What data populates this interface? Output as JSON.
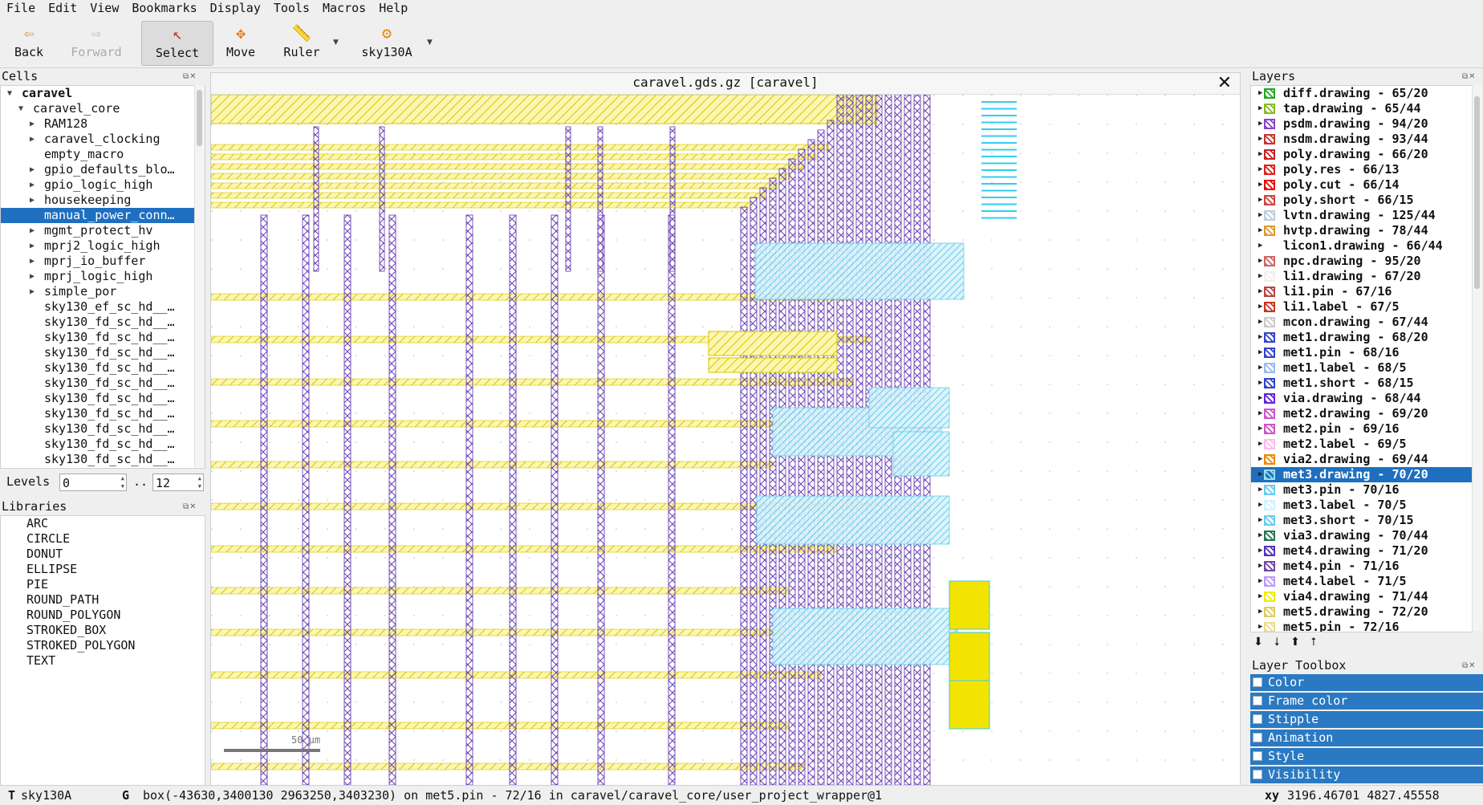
{
  "menu": [
    "File",
    "Edit",
    "View",
    "Bookmarks",
    "Display",
    "Tools",
    "Macros",
    "Help"
  ],
  "toolbar": {
    "back": "Back",
    "forward": "Forward",
    "select": "Select",
    "move": "Move",
    "ruler": "Ruler",
    "tech": "sky130A"
  },
  "cells": {
    "title": "Cells",
    "items": [
      {
        "label": "caravel",
        "indent": 0,
        "arrow": "open",
        "bold": true
      },
      {
        "label": "caravel_core",
        "indent": 1,
        "arrow": "open"
      },
      {
        "label": "RAM128",
        "indent": 2,
        "arrow": "closed"
      },
      {
        "label": "caravel_clocking",
        "indent": 2,
        "arrow": "closed"
      },
      {
        "label": "empty_macro",
        "indent": 2,
        "arrow": "none"
      },
      {
        "label": "gpio_defaults_blo…",
        "indent": 2,
        "arrow": "closed"
      },
      {
        "label": "gpio_logic_high",
        "indent": 2,
        "arrow": "closed"
      },
      {
        "label": "housekeeping",
        "indent": 2,
        "arrow": "closed"
      },
      {
        "label": "manual_power_conn…",
        "indent": 2,
        "arrow": "none",
        "selected": true
      },
      {
        "label": "mgmt_protect_hv",
        "indent": 2,
        "arrow": "closed"
      },
      {
        "label": "mprj2_logic_high",
        "indent": 2,
        "arrow": "closed"
      },
      {
        "label": "mprj_io_buffer",
        "indent": 2,
        "arrow": "closed"
      },
      {
        "label": "mprj_logic_high",
        "indent": 2,
        "arrow": "closed"
      },
      {
        "label": "simple_por",
        "indent": 2,
        "arrow": "closed"
      },
      {
        "label": "sky130_ef_sc_hd__…",
        "indent": 2,
        "arrow": "none"
      },
      {
        "label": "sky130_fd_sc_hd__…",
        "indent": 2,
        "arrow": "none"
      },
      {
        "label": "sky130_fd_sc_hd__…",
        "indent": 2,
        "arrow": "none"
      },
      {
        "label": "sky130_fd_sc_hd__…",
        "indent": 2,
        "arrow": "none"
      },
      {
        "label": "sky130_fd_sc_hd__…",
        "indent": 2,
        "arrow": "none"
      },
      {
        "label": "sky130_fd_sc_hd__…",
        "indent": 2,
        "arrow": "none"
      },
      {
        "label": "sky130_fd_sc_hd__…",
        "indent": 2,
        "arrow": "none"
      },
      {
        "label": "sky130_fd_sc_hd__…",
        "indent": 2,
        "arrow": "none"
      },
      {
        "label": "sky130_fd_sc_hd__…",
        "indent": 2,
        "arrow": "none"
      },
      {
        "label": "sky130_fd_sc_hd__…",
        "indent": 2,
        "arrow": "none"
      },
      {
        "label": "sky130_fd_sc_hd__…",
        "indent": 2,
        "arrow": "none"
      }
    ]
  },
  "levels": {
    "label": "Levels",
    "from": "0",
    "sep": "..",
    "to": "12"
  },
  "libraries": {
    "title": "Libraries",
    "items": [
      "ARC",
      "CIRCLE",
      "DONUT",
      "ELLIPSE",
      "PIE",
      "ROUND_PATH",
      "ROUND_POLYGON",
      "STROKED_BOX",
      "STROKED_POLYGON",
      "TEXT"
    ]
  },
  "canvas": {
    "title": "caravel.gds.gz [caravel]",
    "scale_label": "50 µm"
  },
  "layers": {
    "title": "Layers",
    "items": [
      {
        "label": "diff.drawing - 65/20",
        "color": "#22aa22"
      },
      {
        "label": "tap.drawing - 65/44",
        "color": "#88bb22"
      },
      {
        "label": "psdm.drawing - 94/20",
        "color": "#8844cc"
      },
      {
        "label": "nsdm.drawing - 93/44",
        "color": "#cc3333"
      },
      {
        "label": "poly.drawing - 66/20",
        "color": "#cc2222"
      },
      {
        "label": "poly.res - 66/13",
        "color": "#dd2222"
      },
      {
        "label": "poly.cut - 66/14",
        "color": "#ee0000"
      },
      {
        "label": "poly.short - 66/15",
        "color": "#cc4444"
      },
      {
        "label": "lvtn.drawing - 125/44",
        "color": "#bbccdd"
      },
      {
        "label": "hvtp.drawing - 78/44",
        "color": "#dd9933"
      },
      {
        "label": "licon1.drawing - 66/44",
        "color": "#ffffff"
      },
      {
        "label": "npc.drawing - 95/20",
        "color": "#cc6666"
      },
      {
        "label": "li1.drawing - 67/20",
        "color": "#f0f0f0"
      },
      {
        "label": "li1.pin - 67/16",
        "color": "#bb4444"
      },
      {
        "label": "li1.label - 67/5",
        "color": "#cc3322"
      },
      {
        "label": "mcon.drawing - 67/44",
        "color": "#cccccc"
      },
      {
        "label": "met1.drawing - 68/20",
        "color": "#3344cc"
      },
      {
        "label": "met1.pin - 68/16",
        "color": "#3344cc"
      },
      {
        "label": "met1.label - 68/5",
        "color": "#99bbee"
      },
      {
        "label": "met1.short - 68/15",
        "color": "#3344cc"
      },
      {
        "label": "via.drawing - 68/44",
        "color": "#6622dd"
      },
      {
        "label": "met2.drawing - 69/20",
        "color": "#cc55cc"
      },
      {
        "label": "met2.pin - 69/16",
        "color": "#cc55cc"
      },
      {
        "label": "met2.label - 69/5",
        "color": "#ffbbee"
      },
      {
        "label": "via2.drawing - 69/44",
        "color": "#ee8800"
      },
      {
        "label": "met3.drawing - 70/20",
        "color": "#99ddee",
        "selected": true
      },
      {
        "label": "met3.pin - 70/16",
        "color": "#66ccee"
      },
      {
        "label": "met3.label - 70/5",
        "color": "#ccf4ff"
      },
      {
        "label": "met3.short - 70/15",
        "color": "#66ccee"
      },
      {
        "label": "via3.drawing - 70/44",
        "color": "#227755"
      },
      {
        "label": "met4.drawing - 71/20",
        "color": "#5533bb"
      },
      {
        "label": "met4.pin - 71/16",
        "color": "#7744aa"
      },
      {
        "label": "met4.label - 71/5",
        "color": "#bb99ff"
      },
      {
        "label": "via4.drawing - 71/44",
        "color": "#eeee00"
      },
      {
        "label": "met5.drawing - 72/20",
        "color": "#ddcc66"
      },
      {
        "label": "met5.pin - 72/16",
        "color": "#eedd88"
      }
    ]
  },
  "toolbox": {
    "title": "Layer Toolbox",
    "items": [
      "Color",
      "Frame color",
      "Stipple",
      "Animation",
      "Style",
      "Visibility"
    ]
  },
  "status": {
    "tech_key": "T",
    "tech": "sky130A",
    "grid_key": "G",
    "message": "box(-43630,3400130 2963250,3403230) on met5.pin - 72/16 in caravel/caravel_core/user_project_wrapper@1",
    "xy_label": "xy",
    "xy_value": "3196.46701 4827.45558"
  }
}
